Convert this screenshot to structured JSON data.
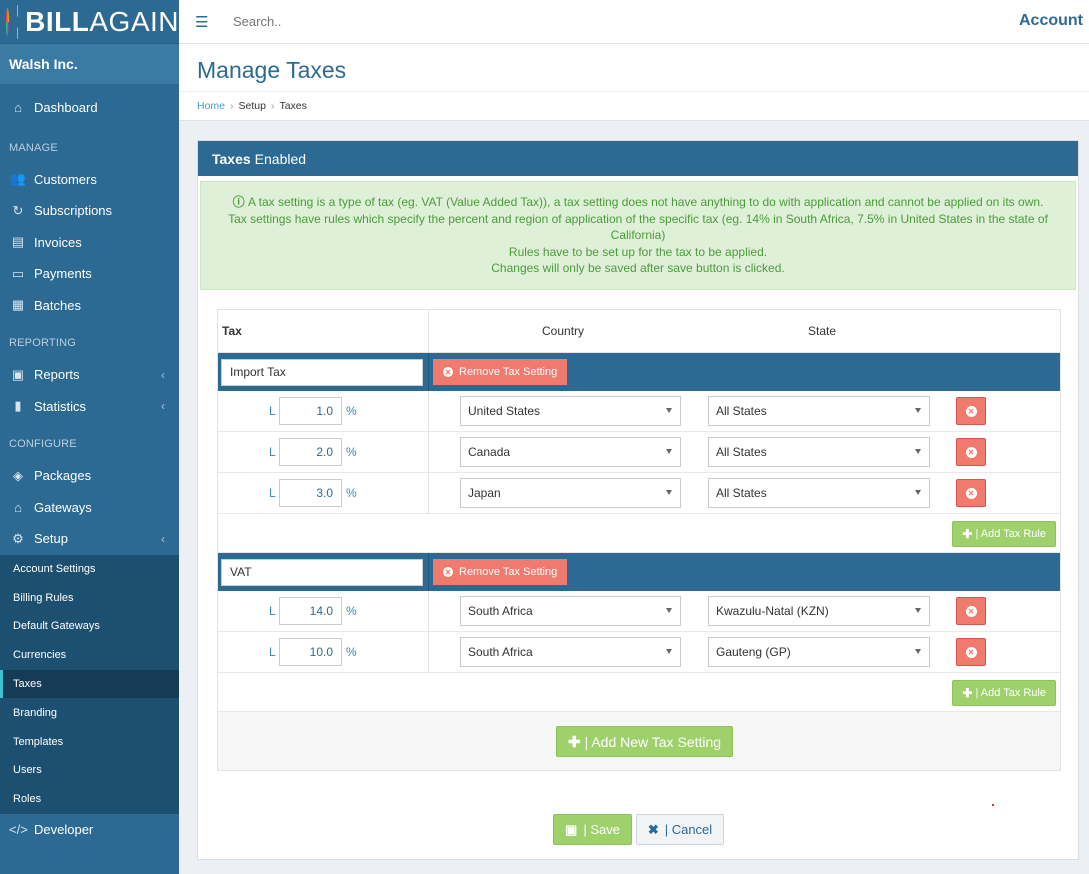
{
  "brand": {
    "bold": "BILL",
    "light": "AGAIN"
  },
  "sidebar": {
    "company": "Walsh Inc.",
    "dashboard": "Dashboard",
    "sections": {
      "manage": "MANAGE",
      "reporting": "REPORTING",
      "configure": "CONFIGURE"
    },
    "manage": [
      "Customers",
      "Subscriptions",
      "Invoices",
      "Payments",
      "Batches"
    ],
    "reporting": [
      "Reports",
      "Statistics"
    ],
    "configure": [
      "Packages",
      "Gateways",
      "Setup"
    ],
    "setup_sub": [
      "Account Settings",
      "Billing Rules",
      "Default Gateways",
      "Currencies",
      "Taxes",
      "Branding",
      "Templates",
      "Users",
      "Roles"
    ],
    "developer": "Developer"
  },
  "topbar": {
    "search_placeholder": "Search..",
    "account": "Account"
  },
  "page": {
    "title": "Manage Taxes"
  },
  "breadcrumb": {
    "home": "Home",
    "setup": "Setup",
    "current": "Taxes"
  },
  "panel": {
    "title_bold": "Taxes",
    "title_rest": "Enabled"
  },
  "alert": {
    "line1": "A tax setting is a type of tax (eg. VAT (Value Added Tax)), a tax setting does not have anything to do with application and cannot be applied on its own.",
    "line2": "Tax settings have rules which specify the percent and region of application of the specific tax (eg. 14% in South Africa, 7.5% in United States in the state of California)",
    "line3": "Rules have to be set up for the tax to be applied.",
    "line4": "Changes will only be saved after save button is clicked."
  },
  "table": {
    "headers": {
      "tax": "Tax",
      "country": "Country",
      "state": "State"
    },
    "rule_prefix": "L",
    "pct_suffix": "%",
    "remove_label": "Remove Tax Setting",
    "add_rule_label": "| Add Tax Rule",
    "settings": [
      {
        "name": "Import Tax",
        "rules": [
          {
            "percent": "1.0",
            "country": "United States",
            "state": "All States"
          },
          {
            "percent": "2.0",
            "country": "Canada",
            "state": "All States"
          },
          {
            "percent": "3.0",
            "country": "Japan",
            "state": "All States"
          }
        ]
      },
      {
        "name": "VAT",
        "rules": [
          {
            "percent": "14.0",
            "country": "South Africa",
            "state": "Kwazulu-Natal (KZN)"
          },
          {
            "percent": "10.0",
            "country": "South Africa",
            "state": "Gauteng (GP)"
          }
        ]
      }
    ],
    "add_setting_label": "| Add New Tax Setting"
  },
  "actions": {
    "save": "| Save",
    "cancel": "| Cancel"
  }
}
